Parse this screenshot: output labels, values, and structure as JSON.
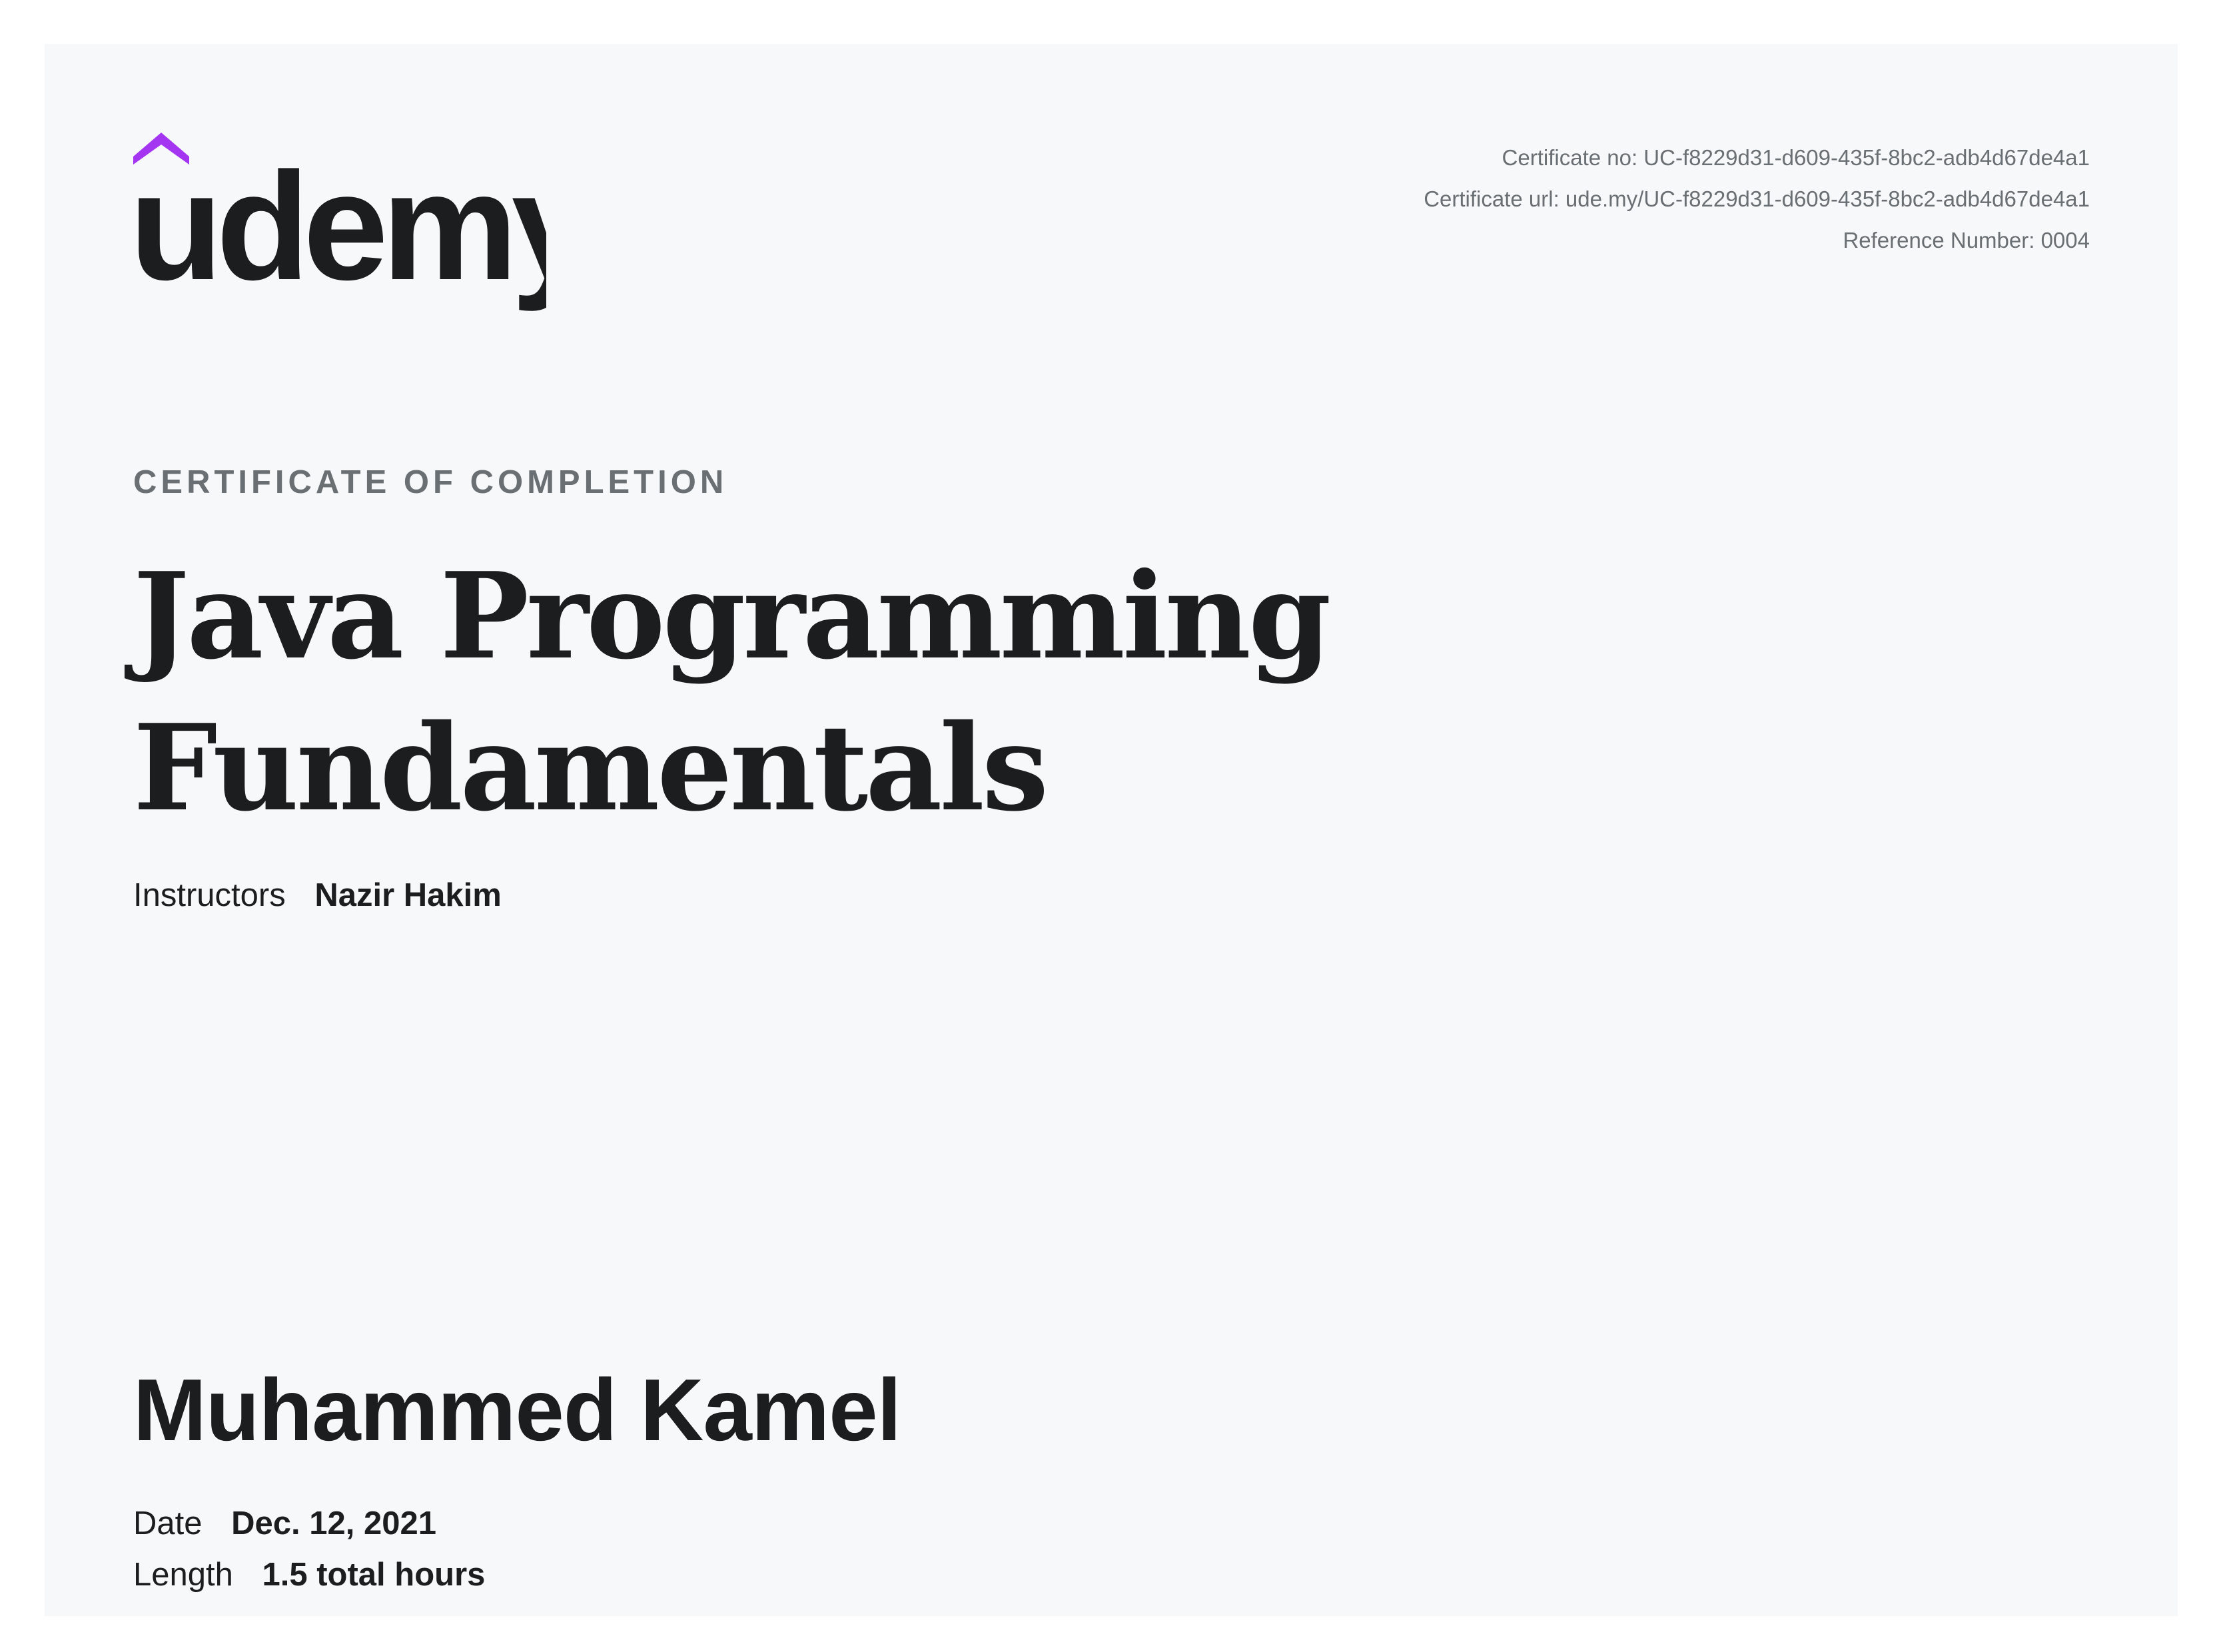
{
  "brand": {
    "name": "udemy",
    "accent_color": "#a435f0",
    "text_color": "#1c1d1f"
  },
  "meta": {
    "certificate_no": "Certificate no: UC-f8229d31-d609-435f-8bc2-adb4d67de4a1",
    "certificate_url": "Certificate url: ude.my/UC-f8229d31-d609-435f-8bc2-adb4d67de4a1",
    "reference_number": "Reference Number: 0004"
  },
  "certificate": {
    "eyebrow": "CERTIFICATE OF COMPLETION",
    "title_line1": "Java Programming",
    "title_line2": "Fundamentals",
    "instructors_label": "Instructors",
    "instructors_value": "Nazir Hakim",
    "recipient": "Muhammed Kamel",
    "date_label": "Date",
    "date_value": "Dec. 12, 2021",
    "length_label": "Length",
    "length_value": "1.5 total hours"
  }
}
